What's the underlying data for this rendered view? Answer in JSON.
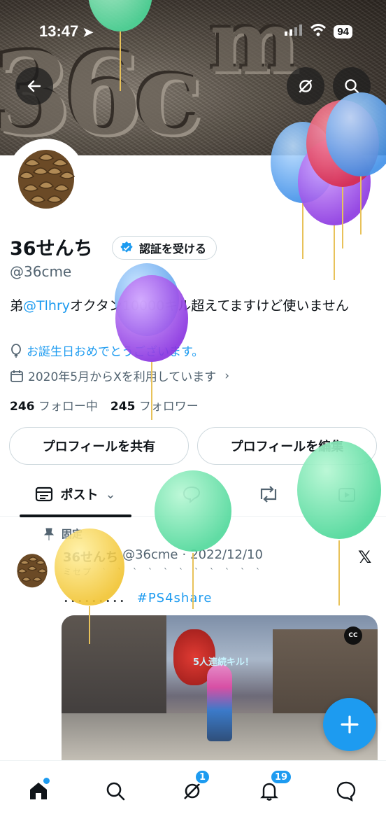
{
  "status_bar": {
    "time": "13:47",
    "battery": "94"
  },
  "profile": {
    "name": "36せんち",
    "verify_label": "認証を受ける",
    "handle": "@36cme",
    "bio_prefix": "弟",
    "bio_mention": "@Tlhry",
    "bio_rest": "オクタン10000キル超えてますけど使いません",
    "birthday": "お誕生日おめでとうございます。",
    "joined": "2020年5月からXを利用しています",
    "following_count": "246",
    "following_label": "フォロー中",
    "followers_count": "245",
    "followers_label": "フォロワー",
    "share_button": "プロフィールを共有",
    "edit_button": "プロフィールを編集"
  },
  "tabs": {
    "posts": "ポスト"
  },
  "tweet": {
    "pinned": "固定",
    "name": "36せんち",
    "handle": "@36cme",
    "separator": "·",
    "date": "2022/12/10",
    "subline": "ミセプ　`　`　`　`　`　`　`　`　`　`　`",
    "dots": "．．．．．．．．．",
    "hashtag": "#PS4share",
    "media_caption": "5人連続キル！",
    "cc_label": "CC"
  },
  "bottom_nav": {
    "grok_badge": "1",
    "notif_badge": "19"
  },
  "colors": {
    "accent": "#1d9bf0",
    "text": "#0f1419",
    "muted": "#536471"
  }
}
